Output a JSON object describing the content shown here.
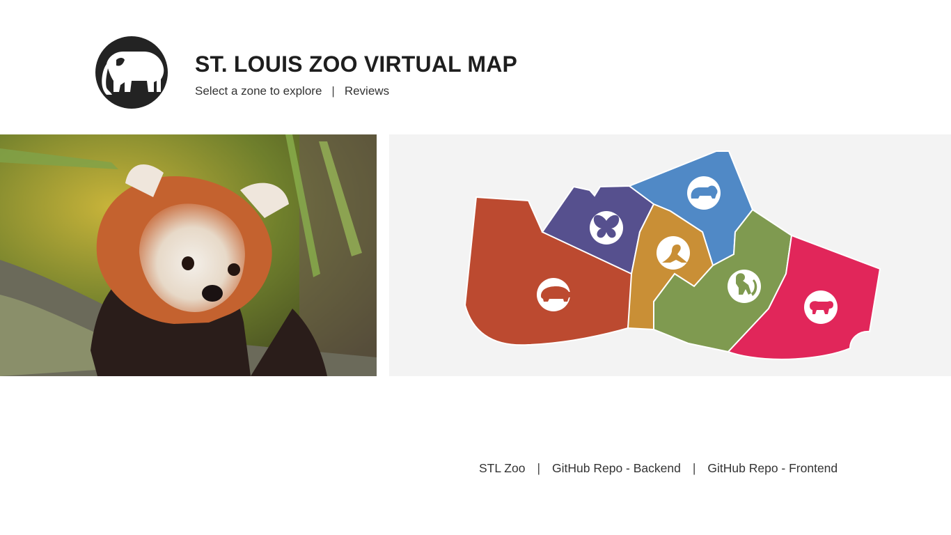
{
  "header": {
    "title": "ST. LOUIS ZOO VIRTUAL MAP",
    "logo_icon": "elephant-icon",
    "nav": [
      {
        "label": "Select a zone to explore"
      },
      {
        "label": "Reviews"
      }
    ],
    "separator": "|"
  },
  "hero_image": {
    "subject": "red-panda-photo"
  },
  "map": {
    "zones": [
      {
        "icon": "hippo-icon",
        "color": "#bc4a30"
      },
      {
        "icon": "butterfly-icon",
        "color": "#56508e"
      },
      {
        "icon": "bear-icon",
        "color": "#5089c6"
      },
      {
        "icon": "sea-lion-icon",
        "color": "#c98f36"
      },
      {
        "icon": "monkey-icon",
        "color": "#7f9a50"
      },
      {
        "icon": "tiger-icon",
        "color": "#e1265a"
      }
    ]
  },
  "footer": {
    "links": [
      {
        "label": "STL Zoo"
      },
      {
        "label": "GitHub Repo - Backend"
      },
      {
        "label": "GitHub Repo - Frontend"
      }
    ],
    "separator": "|"
  }
}
